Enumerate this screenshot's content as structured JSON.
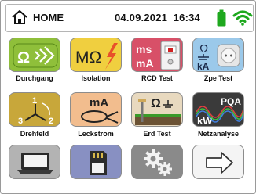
{
  "header": {
    "home_label": "HOME",
    "date": "04.09.2021",
    "time": "16:34",
    "icons": [
      "home-icon",
      "battery-icon",
      "wifi-icon"
    ]
  },
  "tiles": [
    {
      "label": "Durchgang",
      "glyph": "Ω",
      "color": "#8fbf3a"
    },
    {
      "label": "Isolation",
      "glyph": "MΩ",
      "color": "#f0cf3f"
    },
    {
      "label": "RCD Test",
      "glyph_top": "ms",
      "glyph_bottom": "mA",
      "color": "#d85068"
    },
    {
      "label": "Zpe Test",
      "glyph_top": "Ω",
      "glyph_bottom": "kA",
      "color": "#9bc9ea"
    },
    {
      "label": "Drehfeld",
      "glyph_top": "1",
      "glyph_left": "3",
      "glyph_right": "2",
      "color": "#c8a73a"
    },
    {
      "label": "Leckstrom",
      "glyph": "mA",
      "color": "#f2bd8e"
    },
    {
      "label": "Erd Test",
      "glyph": "Ω",
      "color": "#e8d9bf"
    },
    {
      "label": "Netzanalyse",
      "glyph_top": "PQA",
      "glyph_bottom": "kW",
      "color": "#3a3a3a"
    },
    {
      "label": "",
      "icon": "laptop-icon",
      "color": "#b3b3b3"
    },
    {
      "label": "",
      "icon": "memory-card-icon",
      "color": "#8890c2"
    },
    {
      "label": "",
      "icon": "gears-icon",
      "color": "#8a8a8a"
    },
    {
      "label": "",
      "icon": "arrow-right-icon",
      "color": "#f4f4f4"
    }
  ]
}
